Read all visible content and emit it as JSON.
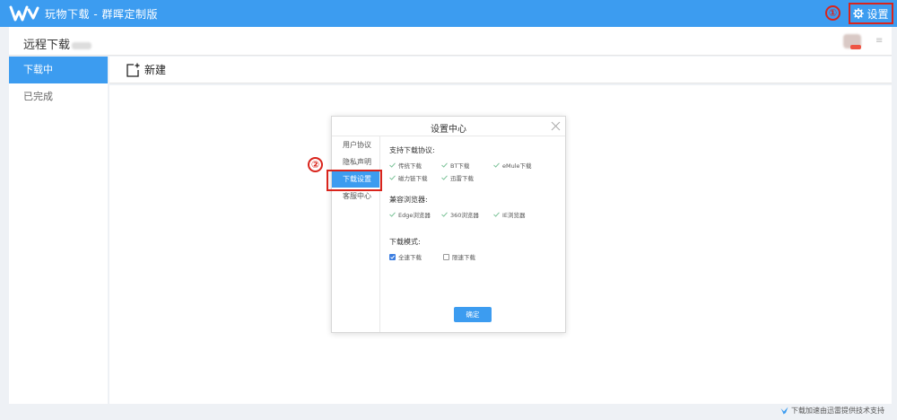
{
  "app": {
    "title": "玩物下载 - 群晖定制版",
    "settings_label": "设置",
    "marker_1": "①",
    "marker_2": "②"
  },
  "header": {
    "page_title": "远程下载"
  },
  "sidebar": {
    "items": [
      {
        "label": "下载中",
        "active": true
      },
      {
        "label": "已完成",
        "active": false
      }
    ]
  },
  "toolbar": {
    "new_label": "新建"
  },
  "dialog": {
    "title": "设置中心",
    "nav": [
      {
        "label": "用户协议",
        "active": false
      },
      {
        "label": "隐私声明",
        "active": false
      },
      {
        "label": "下载设置",
        "active": true
      },
      {
        "label": "客服中心",
        "active": false
      }
    ],
    "protocols_label": "支持下载协议:",
    "protocols": [
      "传统下载",
      "BT下载",
      "eMule下载",
      "磁力链下载",
      "迅雷下载"
    ],
    "browsers_label": "兼容浏览器:",
    "browsers": [
      "Edge浏览器",
      "360浏览器",
      "IE浏览器"
    ],
    "mode_label": "下载模式:",
    "modes": [
      {
        "label": "全速下载",
        "checked": true
      },
      {
        "label": "限速下载",
        "checked": false
      }
    ],
    "confirm_label": "确定"
  },
  "footer": {
    "text": "下载加速由迅雷提供技术支持"
  },
  "colors": {
    "accent": "#3c9cf0",
    "highlight": "#d9241c"
  }
}
